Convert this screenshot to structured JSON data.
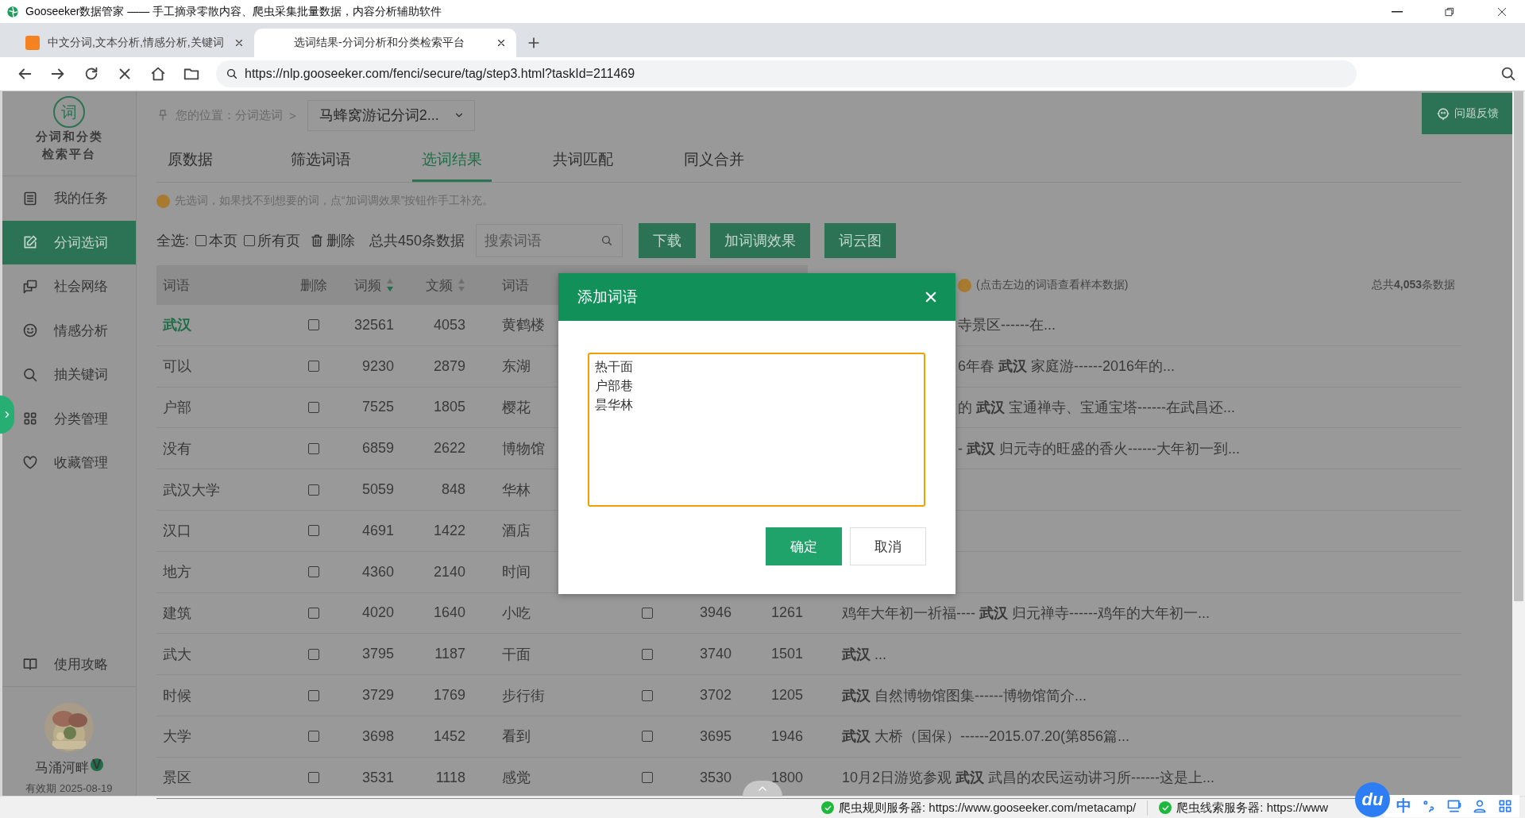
{
  "window": {
    "title": "Gooseeker数据管家 —— 手工摘录零散内容、爬虫采集批量数据，内容分析辅助软件"
  },
  "browser_tabs": [
    {
      "label": "中文分词,文本分析,情感分析,关键词",
      "selected": false
    },
    {
      "label": "选词结果-分词分析和分类检索平台",
      "selected": true
    }
  ],
  "address_bar": {
    "url": "https://nlp.gooseeker.com/fenci/secure/tag/step3.html?taskId=211469"
  },
  "sidebar": {
    "logo": "词",
    "title_lines": [
      "分词和分类",
      "检索平台"
    ],
    "items": [
      {
        "label": "我的任务",
        "selected": false
      },
      {
        "label": "分词选词",
        "selected": true
      },
      {
        "label": "社会网络",
        "selected": false
      },
      {
        "label": "情感分析",
        "selected": false
      },
      {
        "label": "抽关键词",
        "selected": false
      },
      {
        "label": "分类管理",
        "selected": false
      },
      {
        "label": "收藏管理",
        "selected": false
      }
    ],
    "help": "使用攻略",
    "user": {
      "name": "马涌河畔",
      "badge": "V",
      "validity": "有效期 2025-08-19"
    }
  },
  "feedback_button": "问题反馈",
  "breadcrumb": {
    "label": "您的位置：分词选词",
    "separator": ">",
    "project": "马蜂窝游记分词2..."
  },
  "tabs": [
    {
      "label": "原数据",
      "selected": false
    },
    {
      "label": "筛选词语",
      "selected": false
    },
    {
      "label": "选词结果",
      "selected": true
    },
    {
      "label": "共词匹配",
      "selected": false
    },
    {
      "label": "同义合并",
      "selected": false
    }
  ],
  "hint": "先选词，如果找不到想要的词，点“加词调效果”按钮作手工补充。",
  "toolbar": {
    "select_all": "全选:",
    "this_page": {
      "label": "本页",
      "checked": false
    },
    "all_pages": {
      "label": "所有页",
      "checked": false
    },
    "delete": "删除",
    "total": "总共450条数据",
    "search": {
      "placeholder": "搜索词语"
    },
    "buttons": [
      "下载",
      "加词调效果",
      "词云图"
    ]
  },
  "table": {
    "columns": [
      {
        "label": "词语"
      },
      {
        "label": "删除"
      },
      {
        "label": "词频",
        "sortable": true,
        "sort_desc": true
      },
      {
        "label": "文频",
        "sortable": true,
        "sort_desc": false
      },
      {
        "label": "词语"
      }
    ],
    "sample_hint": "(点击左边的词语查看样本数据)",
    "total": "总共**4,053**条数据",
    "rows": [
      {
        "word": "武汉",
        "selected": true,
        "checked": false,
        "freq": "32561",
        "doc_freq": "4053",
        "word_2": "黄鹤楼",
        "sample": "寺景区------在..."
      },
      {
        "word": "可以",
        "selected": false,
        "checked": false,
        "freq": "9230",
        "doc_freq": "2879",
        "word_2": "东湖",
        "sample": "6年春 **武汉** 家庭游------2016年的..."
      },
      {
        "word": "户部",
        "selected": false,
        "checked": false,
        "freq": "7525",
        "doc_freq": "1805",
        "word_2": "樱花",
        "sample": "的 **武汉** 宝通禅寺、宝通宝塔------在武昌还..."
      },
      {
        "word": "没有",
        "selected": false,
        "checked": false,
        "freq": "6859",
        "doc_freq": "2622",
        "word_2": "博物馆",
        "sample": "- **武汉** 归元寺的旺盛的香火------大年初一到..."
      },
      {
        "word": "武汉大学",
        "selected": false,
        "checked": false,
        "freq": "5059",
        "doc_freq": "848",
        "word_2": "华林"
      },
      {
        "word": "汉口",
        "selected": false,
        "checked": false,
        "freq": "4691",
        "doc_freq": "1422",
        "word_2": "酒店"
      },
      {
        "word": "地方",
        "selected": false,
        "checked": false,
        "freq": "4360",
        "doc_freq": "2140",
        "word_2": "时间"
      },
      {
        "word": "建筑",
        "selected": false,
        "checked": false,
        "freq": "4020",
        "doc_freq": "1640",
        "word_2": "小吃",
        "checked_2": false,
        "freq_2": "3946",
        "doc_freq_2": "1261",
        "sample": "鸡年大年初一祈福---- **武汉** 归元禅寺------鸡年的大年初一..."
      },
      {
        "word": "武大",
        "selected": false,
        "checked": false,
        "freq": "3795",
        "doc_freq": "1187",
        "word_2": "干面",
        "checked_2": false,
        "freq_2": "3740",
        "doc_freq_2": "1501",
        "sample": "**武汉** ..."
      },
      {
        "word": "时候",
        "selected": false,
        "checked": false,
        "freq": "3729",
        "doc_freq": "1769",
        "word_2": "步行街",
        "checked_2": false,
        "freq_2": "3702",
        "doc_freq_2": "1205",
        "sample": "**武汉** 自然博物馆图集------博物馆简介..."
      },
      {
        "word": "大学",
        "selected": false,
        "checked": false,
        "freq": "3698",
        "doc_freq": "1452",
        "word_2": "看到",
        "checked_2": false,
        "freq_2": "3695",
        "doc_freq_2": "1946",
        "sample": "**武汉** 大桥（国保）------2015.07.20(第856篇..."
      },
      {
        "word": "景区",
        "selected": false,
        "checked": false,
        "freq": "3531",
        "doc_freq": "1118",
        "word_2": "感觉",
        "checked_2": false,
        "freq_2": "3530",
        "doc_freq_2": "1800",
        "sample": "10月2日游览参观 **武汉** 武昌的农民运动讲习所------这是上..."
      }
    ]
  },
  "modal": {
    "title": "添加词语",
    "lines": [
      "热干面",
      "户部巷",
      "昙华林"
    ],
    "buttons": [
      {
        "label": "确定",
        "kind": "primary"
      },
      {
        "label": "取消",
        "kind": "secondary"
      }
    ]
  },
  "status_bar": [
    {
      "text": "爬虫规则服务器: https://www.gooseeker.com/metacamp/",
      "ok": true
    },
    {
      "text": "爬虫线索服务器: https://www",
      "ok": true
    }
  ],
  "ime": {
    "logo": "du",
    "mode": "中"
  }
}
